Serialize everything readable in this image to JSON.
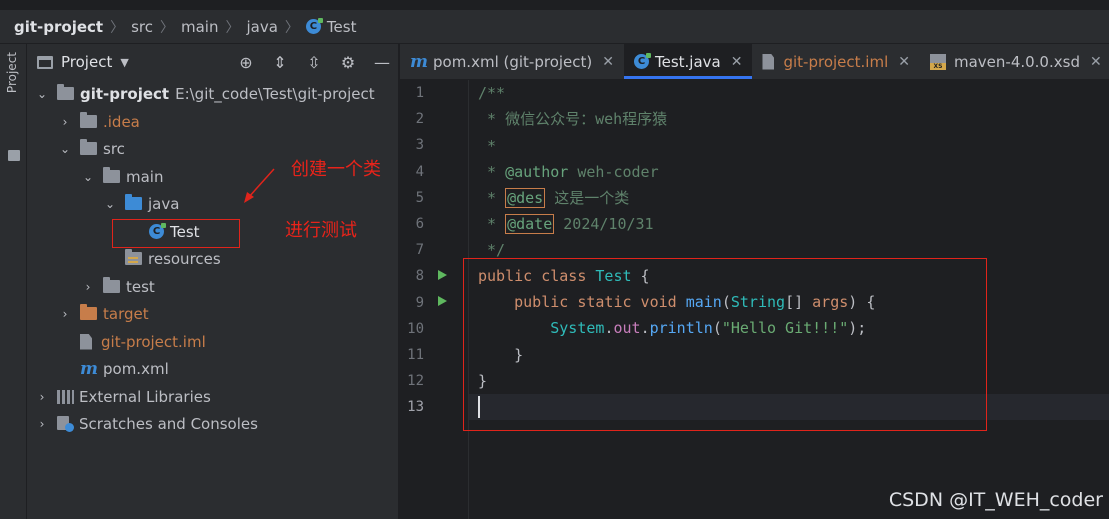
{
  "breadcrumb": [
    "git-project",
    "src",
    "main",
    "java",
    "Test"
  ],
  "tool_strip": {
    "label": "Project"
  },
  "project_panel": {
    "title": "Project",
    "rows": [
      {
        "label": "git-project",
        "path": "E:\\git_code\\Test\\git-project"
      },
      {
        "label": ".idea"
      },
      {
        "label": "src"
      },
      {
        "label": "main"
      },
      {
        "label": "java"
      },
      {
        "label": "Test"
      },
      {
        "label": "resources"
      },
      {
        "label": "test"
      },
      {
        "label": "target"
      },
      {
        "label": "git-project.iml"
      },
      {
        "label": "pom.xml"
      },
      {
        "label": "External Libraries"
      },
      {
        "label": "Scratches and Consoles"
      }
    ]
  },
  "annotations": {
    "create_class": "创建一个类",
    "run_test": "进行测试"
  },
  "tabs": [
    {
      "label": "pom.xml (git-project)",
      "active": false
    },
    {
      "label": "Test.java",
      "active": true
    },
    {
      "label": "git-project.iml",
      "active": false
    },
    {
      "label": "maven-4.0.0.xsd",
      "active": false
    }
  ],
  "editor": {
    "line_numbers": [
      "1",
      "2",
      "3",
      "4",
      "5",
      "6",
      "7",
      "8",
      "9",
      "10",
      "11",
      "12",
      "13"
    ],
    "current_line": "13",
    "code": {
      "l1": "/**",
      "l2": " * 微信公众号：weh程序猿",
      "l3": " *",
      "l4_prefix": " * ",
      "l4_tag": "@author",
      "l4_text": " weh-coder",
      "l5_prefix": " * ",
      "l5_tag": "@des",
      "l5_text": " 这是一个类",
      "l6_prefix": " * ",
      "l6_tag": "@date",
      "l6_text": " 2024/10/31",
      "l7": " */",
      "l8_kw": "public class ",
      "l8_cls": "Test",
      "l8_rest": " {",
      "l9_indent": "    ",
      "l9_kw": "public static void ",
      "l9_fn": "main",
      "l9_p1": "(",
      "l9_type": "String",
      "l9_p2": "[] ",
      "l9_arg": "args",
      "l9_p3": ") {",
      "l10_indent": "        ",
      "l10_cls": "System",
      "l10_dot1": ".",
      "l10_fld": "out",
      "l10_dot2": ".",
      "l10_fn": "println",
      "l10_p1": "(",
      "l10_str": "\"Hello Git!!!\"",
      "l10_p2": ");",
      "l11": "    }",
      "l12": "}"
    }
  },
  "watermark": "CSDN @IT_WEH_coder",
  "colors": {
    "accent": "#3574f0",
    "annotation_red": "#e0241b"
  }
}
